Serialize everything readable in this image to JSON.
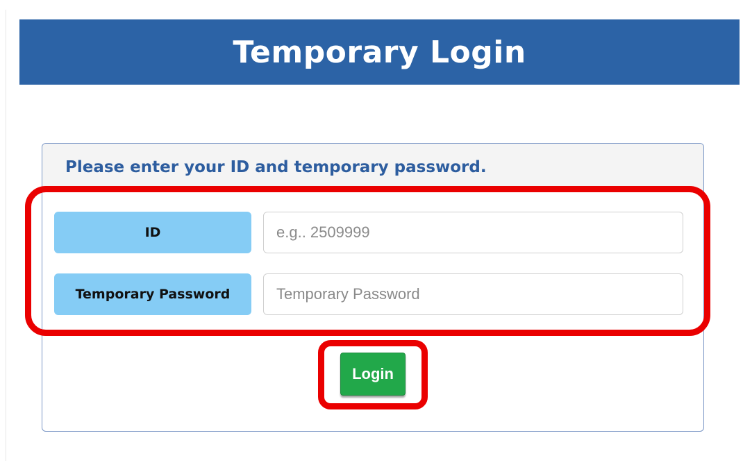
{
  "header": {
    "title": "Temporary Login"
  },
  "card": {
    "instruction": "Please enter your ID and temporary password."
  },
  "form": {
    "id_label": "ID",
    "id_value": "",
    "id_placeholder": "e.g.. 2509999",
    "password_label": "Temporary Password",
    "password_value": "",
    "password_placeholder": "Temporary Password",
    "login_label": "Login"
  },
  "colors": {
    "header_bg": "#2c63a6",
    "label_bg": "#85ccf5",
    "login_button": "#22a84a",
    "highlight": "#ea0000",
    "instruction_text": "#2d5d9f"
  }
}
